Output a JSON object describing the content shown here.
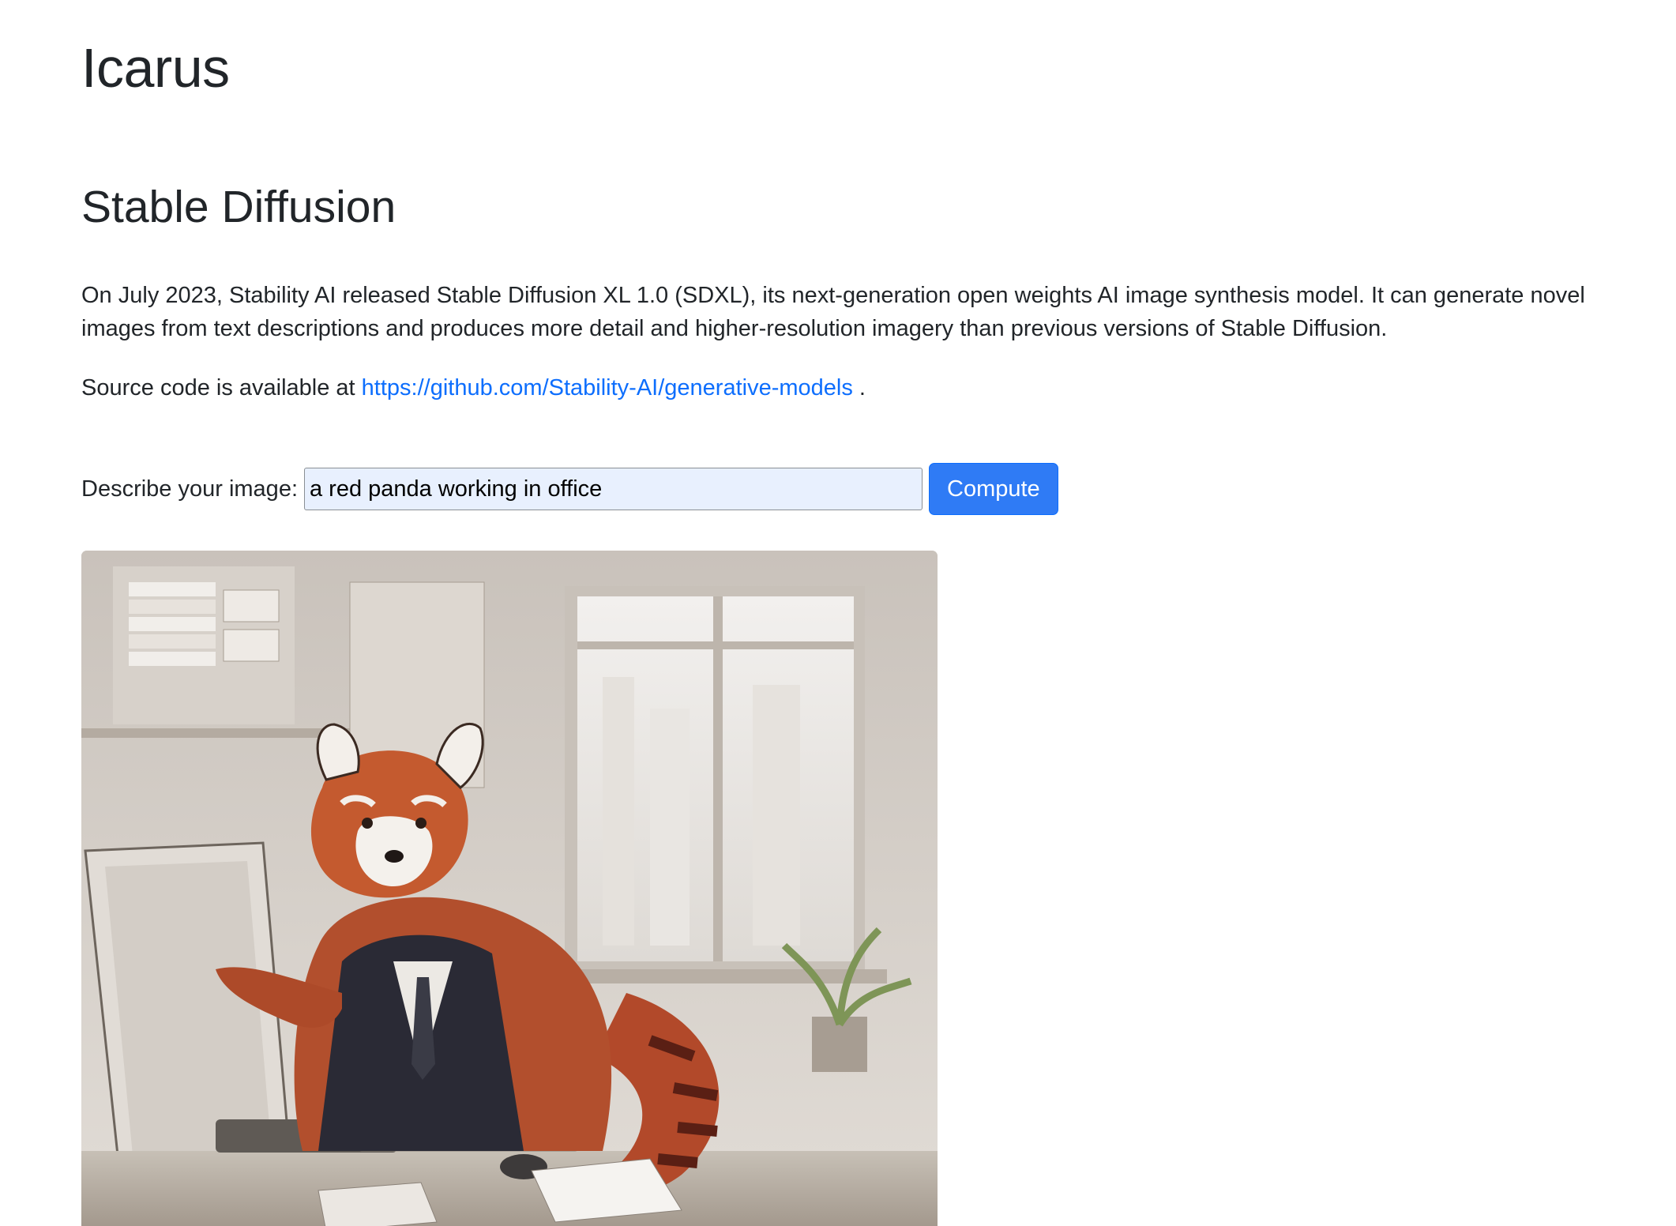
{
  "app": {
    "title": "Icarus"
  },
  "section": {
    "title": "Stable Diffusion",
    "description": "On July 2023, Stability AI released Stable Diffusion XL 1.0 (SDXL), its next-generation open weights AI image synthesis model. It can generate novel images from text descriptions and produces more detail and higher-resolution imagery than previous versions of Stable Diffusion.",
    "source_prefix": "Source code is available at",
    "source_link": "https://github.com/Stability-AI/generative-models",
    "source_suffix": "."
  },
  "form": {
    "label": "Describe your image:",
    "prompt_value": "a red panda working in office",
    "submit_label": "Compute"
  },
  "result": {
    "image": "generated-image"
  },
  "colors": {
    "link": "#0d6efd",
    "button": "#2f7bf5",
    "input_background": "#e8f0fe"
  }
}
